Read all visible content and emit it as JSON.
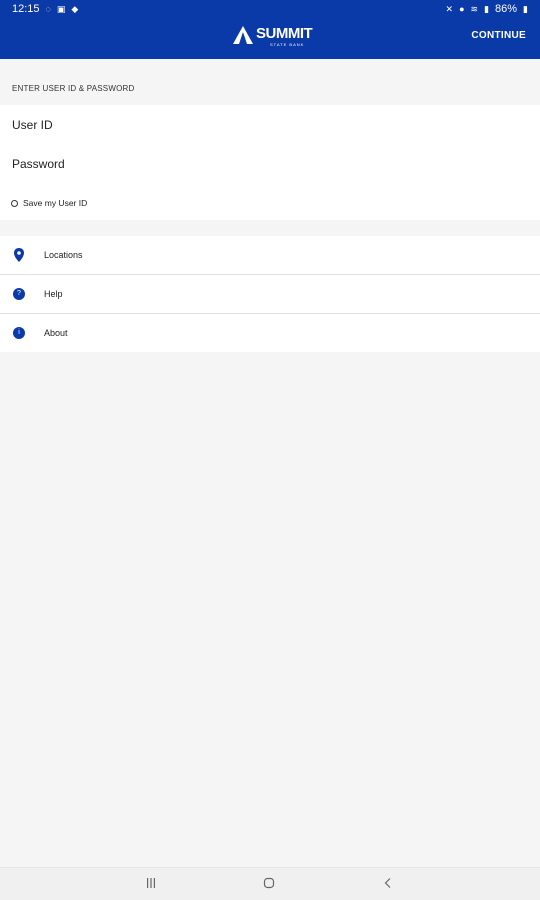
{
  "status_bar": {
    "time": "12:15",
    "battery": "86%"
  },
  "app_bar": {
    "logo_main": "SUMMIT",
    "logo_sub": "STATE BANK",
    "continue_label": "CONTINUE"
  },
  "login": {
    "section_label": "ENTER USER ID & PASSWORD",
    "user_id_placeholder": "User ID",
    "password_placeholder": "Password",
    "save_user_id_label": "Save my User ID"
  },
  "menu": {
    "items": [
      {
        "label": "Locations",
        "icon": "location-pin-icon"
      },
      {
        "label": "Help",
        "icon": "help-icon",
        "glyph": "?"
      },
      {
        "label": "About",
        "icon": "info-icon",
        "glyph": "i"
      }
    ]
  },
  "colors": {
    "brand_blue": "#0a39a8",
    "background": "#f5f5f5"
  }
}
